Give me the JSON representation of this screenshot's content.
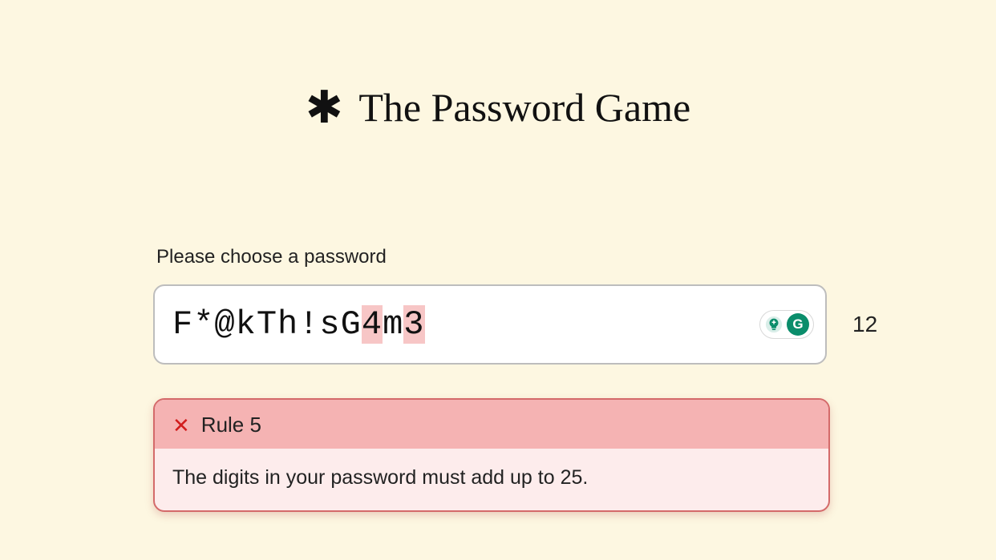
{
  "page": {
    "title_text": "The Password Game"
  },
  "prompt": "Please choose a password",
  "password": {
    "segments": [
      {
        "text": "F*@kTh!sG",
        "hl": false
      },
      {
        "text": "4",
        "hl": true
      },
      {
        "text": "m",
        "hl": false
      },
      {
        "text": "3",
        "hl": true
      }
    ],
    "char_count": "12"
  },
  "grammarly": {
    "logo_letter": "G"
  },
  "rule": {
    "label": "Rule 5",
    "text": "The digits in your password must add up to 25."
  }
}
